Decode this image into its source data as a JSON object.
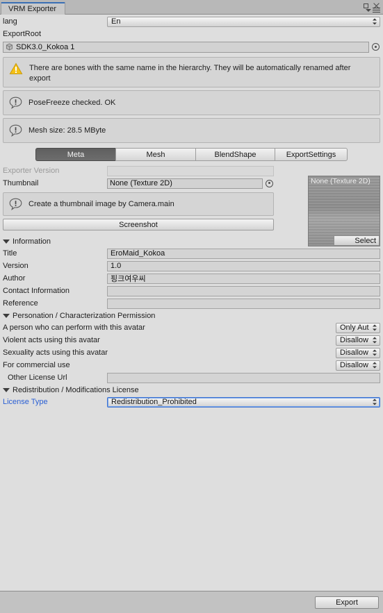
{
  "window": {
    "tab_title": "VRM Exporter",
    "maximize_icon": "maximize-icon",
    "close_icon": "close-icon",
    "caret_icon": "chevron-down-icon",
    "menu_icon": "hamburger-menu-icon"
  },
  "top": {
    "lang_label": "lang",
    "lang_value": "En",
    "export_root_label": "ExportRoot",
    "export_root_value": "SDK3.0_Kokoa 1",
    "prefab_icon": "prefab-cube-icon",
    "picker_icon": "object-picker-icon"
  },
  "messages": [
    {
      "icon": "warning-icon",
      "type": "warning",
      "text": "There are bones with the same name in the hierarchy. They will be automatically renamed after export"
    },
    {
      "icon": "info-icon",
      "type": "info",
      "text": "PoseFreeze checked. OK"
    },
    {
      "icon": "info-icon",
      "type": "info",
      "text": "Mesh size: 28.5 MByte"
    }
  ],
  "tabs": [
    {
      "label": "Meta",
      "active": true
    },
    {
      "label": "Mesh",
      "active": false
    },
    {
      "label": "BlendShape",
      "active": false
    },
    {
      "label": "ExportSettings",
      "active": false
    }
  ],
  "meta": {
    "exporter_version_label": "Exporter Version",
    "exporter_version_value": "",
    "thumbnail_label": "Thumbnail",
    "thumbnail_value": "None (Texture 2D)",
    "thumbnail_hint_icon": "info-icon",
    "thumbnail_hint": "Create a thumbnail image by Camera.main",
    "screenshot_button": "Screenshot",
    "preview_label": "None (Texture 2D)",
    "preview_select_button": "Select"
  },
  "information": {
    "section_title": "Information",
    "fields": [
      {
        "label": "Title",
        "value": "EroMaid_Kokoa"
      },
      {
        "label": "Version",
        "value": "1.0"
      },
      {
        "label": "Author",
        "value": "핑크여우씨"
      },
      {
        "label": "Contact Information",
        "value": ""
      },
      {
        "label": "Reference",
        "value": ""
      }
    ]
  },
  "permission": {
    "section_title": "Personation / Characterization Permission",
    "rows": [
      {
        "label": "A person who can perform with this avatar",
        "value": "Only Aut"
      },
      {
        "label": "Violent acts using this avatar",
        "value": "Disallow"
      },
      {
        "label": "Sexuality acts using this avatar",
        "value": "Disallow"
      },
      {
        "label": "For commercial use",
        "value": "Disallow"
      }
    ],
    "other_license_url_label": "Other License Url",
    "other_license_url_value": ""
  },
  "redistribution": {
    "section_title": "Redistribution / Modifications License",
    "license_type_label": "License Type",
    "license_type_value": "Redistribution_Prohibited"
  },
  "footer": {
    "export_button": "Export"
  },
  "colors": {
    "background": "#dedede",
    "chrome": "#c2c2c2",
    "accent_blue": "#3a6fb5",
    "link_blue": "#2a5fd4",
    "warning_yellow": "#f5c116"
  }
}
